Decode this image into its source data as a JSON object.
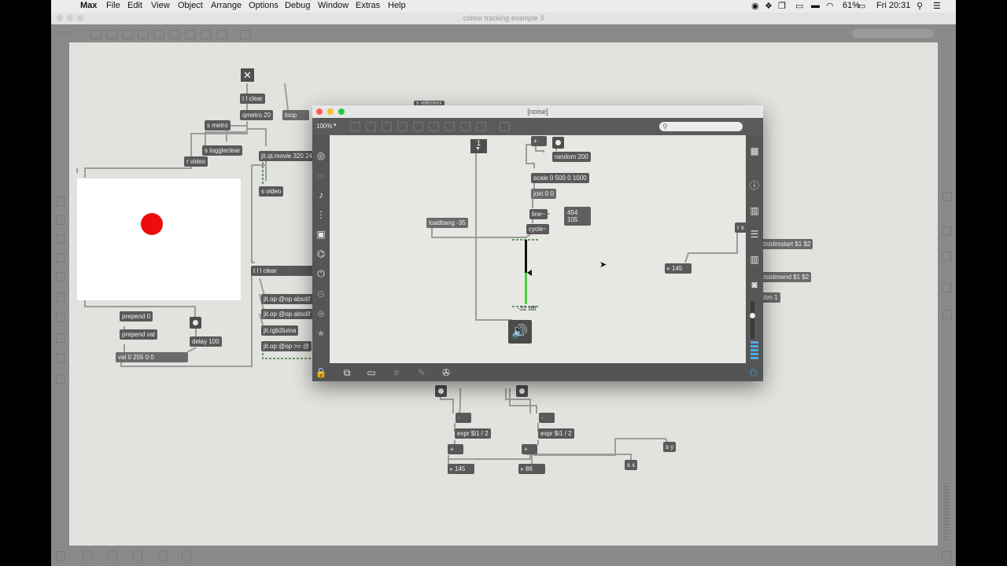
{
  "menubar": {
    "app": "Max",
    "items": [
      "File",
      "Edit",
      "View",
      "Object",
      "Arrange",
      "Options",
      "Debug",
      "Window",
      "Extras",
      "Help"
    ],
    "battery": "61%",
    "clock": "Fri 20:31"
  },
  "window": {
    "title": "colour tracking example 3",
    "zoom": "100%"
  },
  "main_patch": {
    "close_button": "✕",
    "objects": {
      "t_l_clear": "t l clear",
      "qmetro": "qmetro 20",
      "loop": "loop",
      "s_metro": "s metro",
      "s_toggleclear": "s toggleclear",
      "jit_qt_movie": "jit.qt.movie 320 24",
      "r_video": "r video",
      "s_video": "s video",
      "s_videoxxx": "s videoxxx",
      "t_l_l_clear": "t l l clear",
      "jit_op_1": "jit.op @op absdif",
      "jit_op_2": "jit.op @op absdif",
      "jit_rgb2luma": "jit.rgb2luma",
      "jit_op_3": "jit.op @op >= @",
      "prepend_0": "prepend 0",
      "prepend_val": "prepend val",
      "delay": "delay 100",
      "val_msg": "val 0 255 0 0",
      "minus_1": "-",
      "minus_2": "-",
      "expr_1": "expr $i1 / 2",
      "expr_2": "expr $i1 / 2",
      "plus_1": "+",
      "plus_2": "+",
      "num_x": "145",
      "num_y": "86",
      "s_y": "s y",
      "s_x": "s x",
      "dstdimstart": "dstdimstart $1 $2",
      "dstdimend": "dstdimend $1 $2",
      "dim": "dim 1"
    }
  },
  "noise_window": {
    "title": "[noise]",
    "zoom": "100%",
    "objects": {
      "numbox_one": "1",
      "plus": "+",
      "random": "random 200",
      "scale": "scale 0 500 0 1000",
      "join": "join 0 0",
      "line": "line~",
      "xy_line1": "454",
      "xy_line2": "105",
      "cycle": "cycle~",
      "loadbang": "loadbang -35",
      "gain_db": "-32 dB",
      "rx": "r x",
      "num_145": "145"
    }
  }
}
